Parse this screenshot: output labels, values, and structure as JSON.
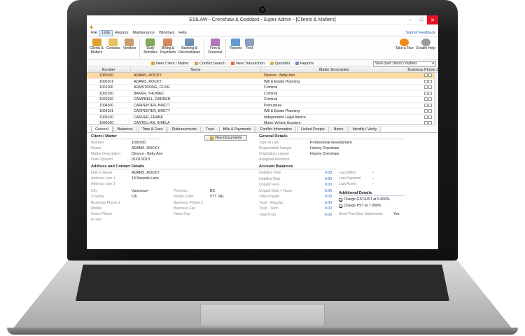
{
  "window": {
    "title": "ESILAW - Crenshaw & Goddard - Super Admin - [Clients & Matters]",
    "minimize": "–",
    "maximize": "□",
    "close": "✕"
  },
  "menu": {
    "items": [
      "File",
      "Lists",
      "Reports",
      "Maintenance",
      "Windows",
      "Help"
    ],
    "active": "Lists",
    "feedback": "Submit Feedback"
  },
  "ribbon": {
    "buttons": [
      {
        "label": "Clients &\nMatters",
        "icon": "clients-matters-icon",
        "color": "#e0a030"
      },
      {
        "label": "Contacts",
        "icon": "contacts-icon",
        "color": "#e8c060"
      },
      {
        "label": "Vendors",
        "icon": "vendors-icon",
        "color": "#c8a070"
      },
      {
        "label": "Daily\nActivities",
        "icon": "daily-activities-icon",
        "color": "#7fa85a"
      },
      {
        "label": "Billing &\nPayments",
        "icon": "billing-icon",
        "color": "#d08a5a"
      },
      {
        "label": "Banking &\nReconciliation",
        "icon": "banking-icon",
        "color": "#6f8fb8"
      },
      {
        "label": "Firm &\nFinancial",
        "icon": "firm-icon",
        "color": "#b07ab8"
      },
      {
        "label": "Reports",
        "icon": "reports-icon",
        "color": "#5f9bd0"
      },
      {
        "label": "Find",
        "icon": "find-icon",
        "color": "#8aa0c0"
      }
    ],
    "tour": {
      "label": "Take a Tour",
      "icon": "tour-icon",
      "color": "#f08a1a"
    },
    "help": {
      "label": "Enable Help",
      "icon": "help-icon",
      "color": "#9a9a9a"
    }
  },
  "toolbar": {
    "items": [
      {
        "label": "New Client / Matter",
        "color": "#e0a030"
      },
      {
        "label": "Conflict Search",
        "color": "#d0a050"
      },
      {
        "label": "New Transaction",
        "color": "#e06a30"
      },
      {
        "label": "Quickbill",
        "color": "#d8b040"
      },
      {
        "label": "Reports",
        "color": "#6f8fb8"
      }
    ],
    "view": "View open clients / matters"
  },
  "grid": {
    "columns": [
      "Number",
      "Name",
      "Matter Description",
      "Business Phone 1"
    ],
    "rows": [
      {
        "number": "1000100",
        "name": "ADAMS, ROCKY",
        "desc": "Divorce - Betty Ann"
      },
      {
        "number": "1000101",
        "name": "ADAMS, ROCKY",
        "desc": "Will & Estate Planning"
      },
      {
        "number": "1001100",
        "name": "ARMSTRONG, CLIVE",
        "desc": "Criminal"
      },
      {
        "number": "1002100",
        "name": "BAKER, THOMAS",
        "desc": "Criminal"
      },
      {
        "number": "1003100",
        "name": "CAMPBELL, DARREN",
        "desc": "Criminal"
      },
      {
        "number": "1004100",
        "name": "CARPENTER, BRETT",
        "desc": "Prenuptual"
      },
      {
        "number": "1004101",
        "name": "CARPENTER, BRETT",
        "desc": "Will & Estate Planning"
      },
      {
        "number": "1005100",
        "name": "CARVER, FRANK",
        "desc": "Independent Legal Advice"
      },
      {
        "number": "1006100",
        "name": "CASTELLAN, SHIELA",
        "desc": "Motor Vehicle Accident"
      }
    ],
    "selected": 0
  },
  "tabs": [
    "General",
    "Balances",
    "Time & Fees",
    "Disbursements",
    "Trust",
    "Bills & Payments",
    "Conflict Information",
    "Linked People",
    "Notes",
    "Identify / Verify"
  ],
  "client": {
    "heading": "Client / Matter",
    "number_label": "Number",
    "number": "1000100",
    "name_label": "Name",
    "name": "ADAMS, ROCKY",
    "desc_label": "Matter Description",
    "desc": "Divorce - Betty Ann",
    "opened_label": "Date Opened",
    "opened": "01/01/2013",
    "view_docs": "View Documents"
  },
  "address": {
    "heading": "Address and Contact Details",
    "mail_label": "Mail to Name",
    "mail": "ADAMS, ROCKY",
    "line1_label": "Address Line 1",
    "line1": "19 Marpole Lane",
    "line2_label": "Address Line 2",
    "city_label": "City",
    "city": "Vancouver",
    "country_label": "Country",
    "country": "CA",
    "phone1_label": "Business Phone 1",
    "mobile_label": "Mobile",
    "home_label": "Home Phone",
    "email_label": "E-mail",
    "province_label": "Province",
    "province": "BC",
    "postal_label": "Postal Code",
    "postal": "V7T 2A1",
    "phone2_label": "Business Phone 2",
    "fax_label": "Business Fax",
    "homefax_label": "Home Fax"
  },
  "general": {
    "heading": "General Details",
    "type_label": "Type of Law",
    "type": "Professional development",
    "resp_label": "Responsible Lawyer",
    "resp": "Harvey Crenshaw",
    "orig_label": "Originating Lawyer",
    "orig": "Harvey Crenshaw",
    "asst_label": "Assigned Assistant"
  },
  "balances": {
    "heading": "Account Balances",
    "items": [
      {
        "label": "Unbilled Time",
        "value": "0.00"
      },
      {
        "label": "Unbilled Disb",
        "value": "0.00"
      },
      {
        "label": "Unpaid Fees",
        "value": "0.00"
      },
      {
        "label": "Unpaid Disb + Taxes",
        "value": "0.00"
      },
      {
        "label": "Total Unpaid",
        "value": "0.00"
      },
      {
        "label": "Trust - Regular",
        "value": "0.00"
      },
      {
        "label": "Trust - Term",
        "value": "0.00"
      },
      {
        "label": "Total Trust",
        "value": "0.00"
      }
    ],
    "last_billed_label": "Last Billed",
    "last_billed": "-",
    "last_payment_label": "Last Payment",
    "last_payment": "-",
    "last_active_label": "Last Active",
    "last_active": "-"
  },
  "additional": {
    "heading": "Additional Details",
    "gst": "Charge GST/HST at 5.000%",
    "pst": "Charge PST at 7.000%",
    "statements_label": "Send Past Due Statements",
    "statements": "Yes"
  }
}
